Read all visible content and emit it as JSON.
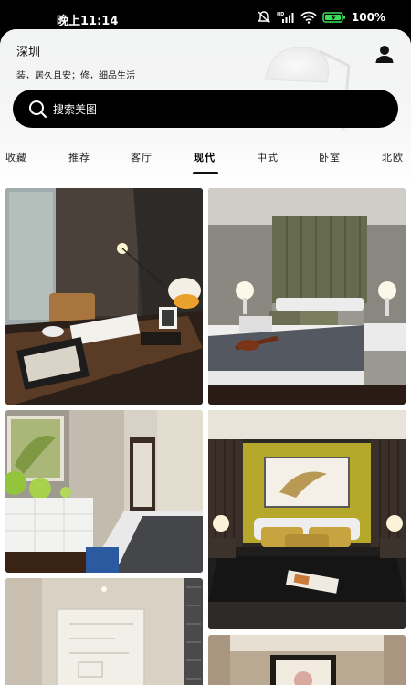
{
  "status_bar": {
    "time": "晚上11:14",
    "battery": "100%",
    "icons": [
      "mute-icon",
      "signal-icon",
      "wifi-icon",
      "battery-icon"
    ]
  },
  "header": {
    "city": "深圳",
    "slogan": "装，居久且安；修，细品生活",
    "profile_icon": "person-icon"
  },
  "search": {
    "placeholder": "搜索美图",
    "icon": "search-icon"
  },
  "tabs": [
    {
      "label": "收藏"
    },
    {
      "label": "推荐"
    },
    {
      "label": "客厅"
    },
    {
      "label": "现代",
      "active": true
    },
    {
      "label": "中式"
    },
    {
      "label": "卧室"
    },
    {
      "label": "北欧"
    }
  ],
  "grid": {
    "images": [
      {
        "name": "study-room-photo"
      },
      {
        "name": "modern-bedroom-photo"
      },
      {
        "name": "bedroom-with-sideboard-photo"
      },
      {
        "name": "yellow-headboard-bedroom-photo"
      },
      {
        "name": "blank-wall-room-photo"
      },
      {
        "name": "framed-art-room-photo"
      }
    ]
  },
  "colors": {
    "background": "#ffffff",
    "search_bar": "#000000",
    "text": "#111111"
  }
}
